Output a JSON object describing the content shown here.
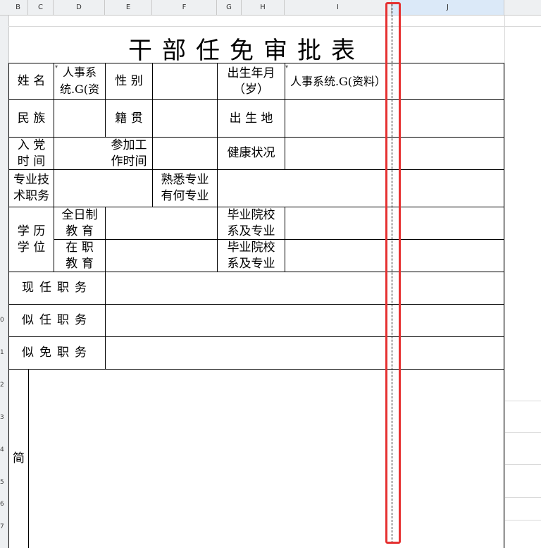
{
  "columns": [
    "B",
    "C",
    "D",
    "E",
    "F",
    "G",
    "H",
    "I",
    "J"
  ],
  "row_numbers": [
    "0",
    "1",
    "2",
    "3",
    "4",
    "5",
    "6",
    "7"
  ],
  "form": {
    "title": "干部任免审批表",
    "name_label": "姓 名",
    "name_value": "人事系统.G(资",
    "gender_label": "性 别",
    "birth_label": "出生年月（岁）",
    "birth_value": "人事系统.G(资料）",
    "ethnic_label": "民 族",
    "native_label": "籍 贯",
    "birthplace_label": "出 生 地",
    "party_label": "入 党 时 间",
    "work_start_label": "参加工作时间",
    "health_label": "健康状况",
    "tech_label": "专业技术职务",
    "skill_label": "熟悉专业有何专业",
    "edu_label": "学 历 学 位",
    "fulltime_label": "全日制教 育",
    "fulltime_school_label": "毕业院校系及专业",
    "inservice_label": "在 职 教 育",
    "inservice_school_label": "毕业院校系及专业",
    "current_post_label": "现任职务",
    "proposed_post_label": "似任职务",
    "proposed_remove_label": "似免职务",
    "resume_label": "简"
  }
}
